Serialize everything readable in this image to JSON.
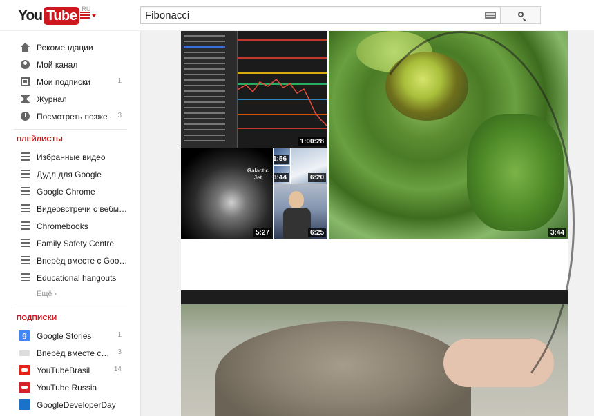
{
  "header": {
    "logo_you": "You",
    "logo_tube": "Tube",
    "logo_region": "RU",
    "search_value": "Fibonacci"
  },
  "sidebar": {
    "main_items": [
      {
        "label": "Рекомендации",
        "icon": "home-icon",
        "count": ""
      },
      {
        "label": "Мой канал",
        "icon": "user-icon",
        "count": ""
      },
      {
        "label": "Мои подписки",
        "icon": "subscriptions-icon",
        "count": "1"
      },
      {
        "label": "Журнал",
        "icon": "history-icon",
        "count": ""
      },
      {
        "label": "Посмотреть позже",
        "icon": "clock-icon",
        "count": "3"
      }
    ],
    "playlists_title": "ПЛЕЙЛИСТЫ",
    "playlists": [
      {
        "label": "Избранные видео"
      },
      {
        "label": "Дудл для Google"
      },
      {
        "label": "Google Chrome"
      },
      {
        "label": "Видеовстречи с вебм…"
      },
      {
        "label": "Chromebooks"
      },
      {
        "label": "Family Safety Centre"
      },
      {
        "label": "Вперёд вместе с Goo…"
      },
      {
        "label": "Educational hangouts"
      }
    ],
    "more_label": "Ещё ›",
    "subscriptions_title": "ПОДПИСКИ",
    "subscriptions": [
      {
        "label": "Google Stories",
        "count": "1",
        "icon": "google-icon",
        "icon_text": "g"
      },
      {
        "label": "Вперёд вместе с…",
        "count": "3",
        "icon": "channel-logo-icon",
        "icon_text": ""
      },
      {
        "label": "YouTubeBrasil",
        "count": "14",
        "icon": "youtube-brasil-icon",
        "icon_text": ""
      },
      {
        "label": "YouTube Russia",
        "count": "",
        "icon": "youtube-russia-icon",
        "icon_text": ""
      },
      {
        "label": "GoogleDeveloperDay",
        "count": "",
        "icon": "gdd-icon",
        "icon_text": ""
      }
    ]
  },
  "videos": {
    "chart": {
      "duration": "1:00:28"
    },
    "galactic": {
      "duration": "5:27",
      "overlay_text": "Galactic\nJet"
    },
    "small1": {
      "duration": "1:56"
    },
    "small2": {
      "duration": "3:44"
    },
    "small3": {
      "duration": "6:20"
    },
    "person": {
      "duration": "6:25"
    },
    "dragonfly": {
      "duration": "3:44"
    }
  }
}
